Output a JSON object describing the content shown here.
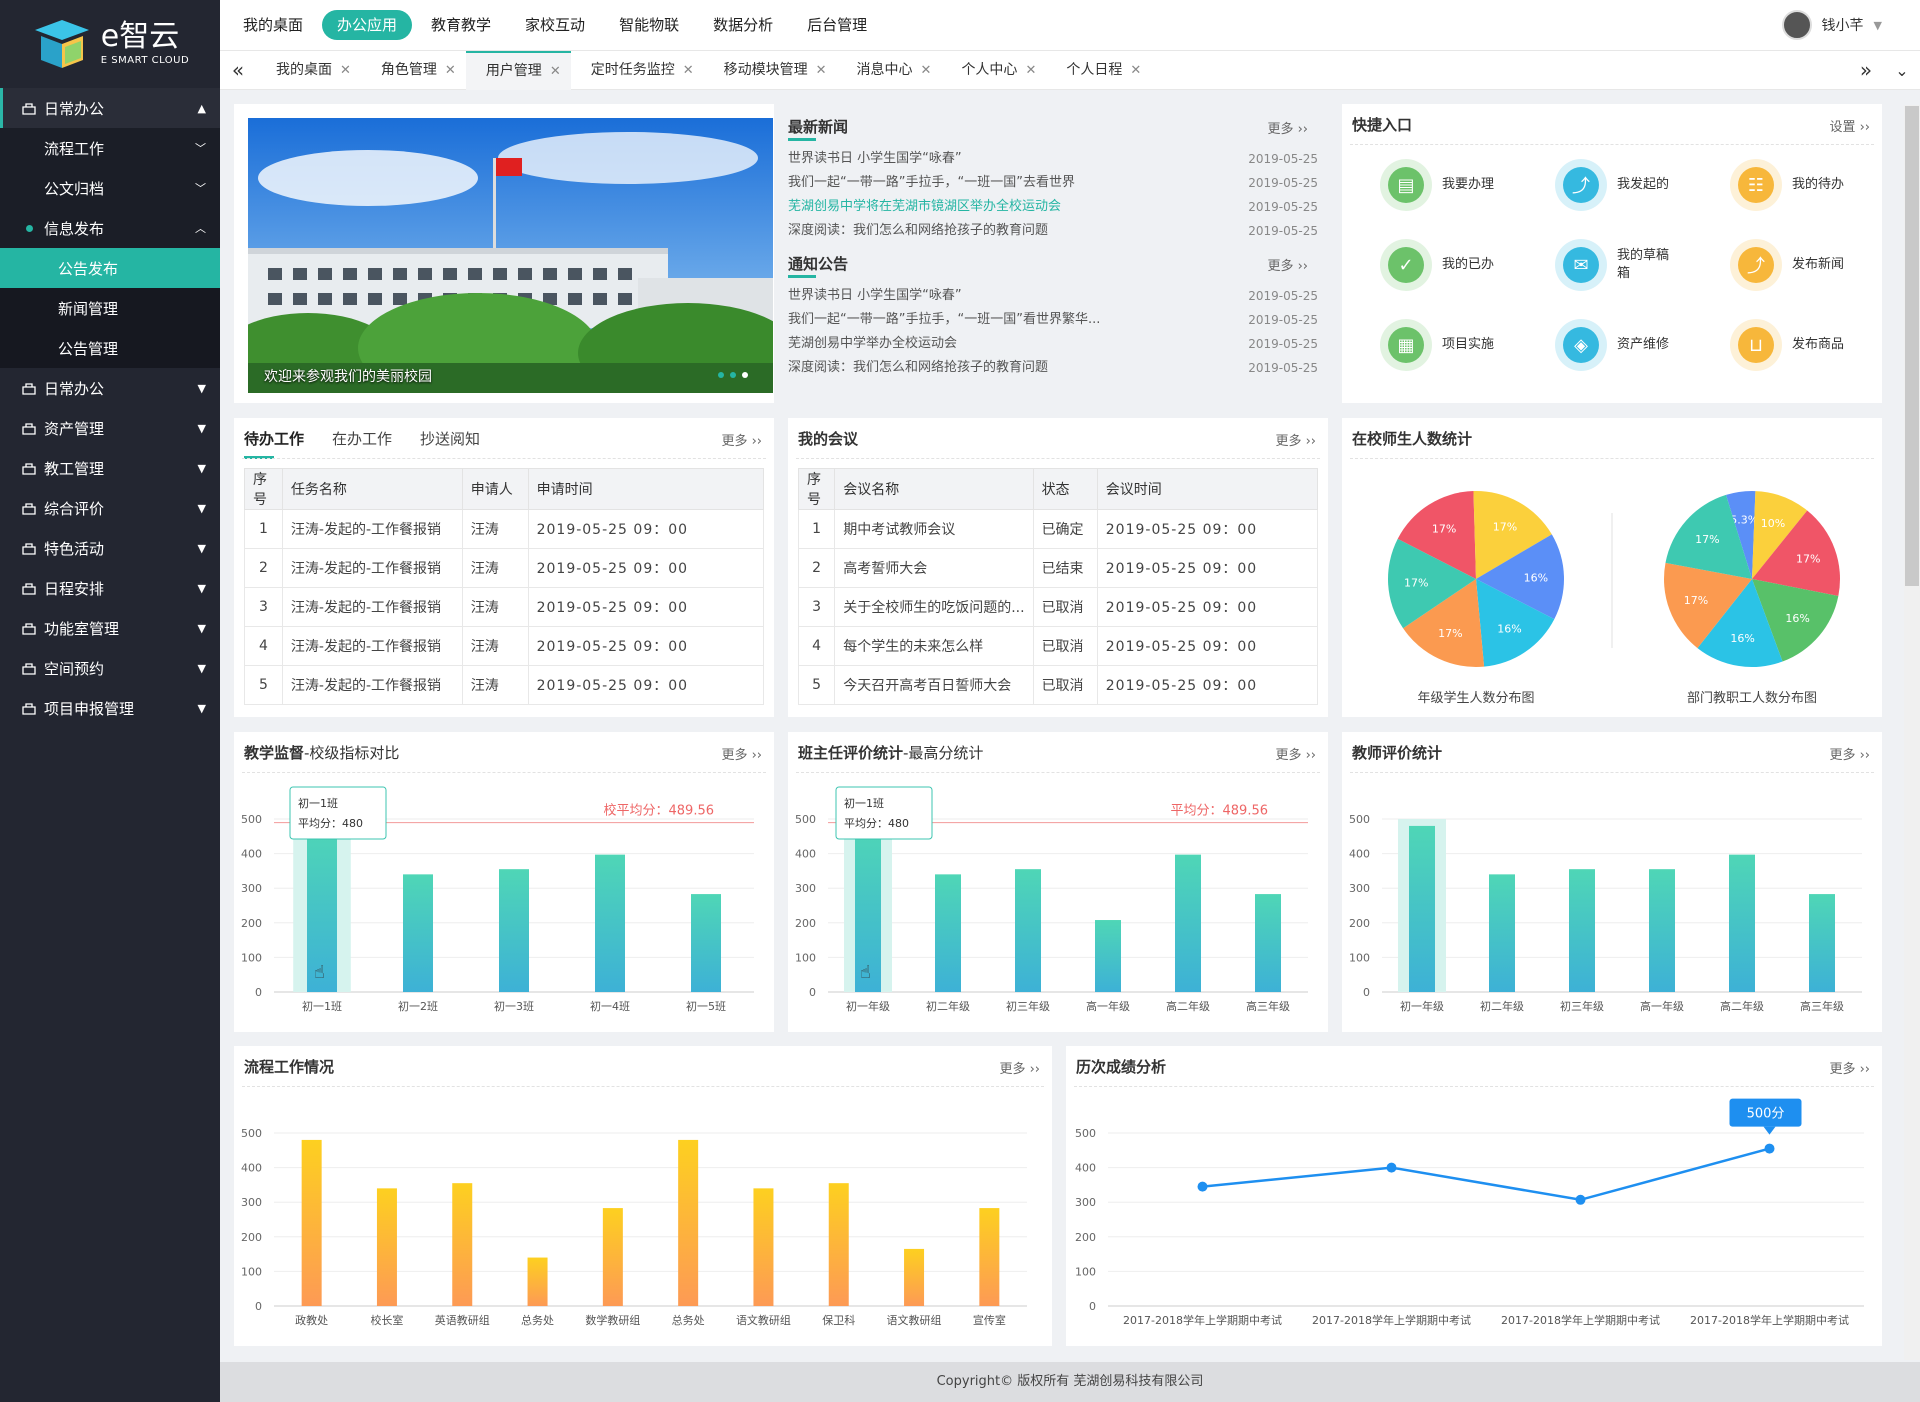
{
  "app": {
    "logo_main": "e智云",
    "logo_sub": "E SMART CLOUD"
  },
  "top_menu": [
    "我的桌面",
    "办公应用",
    "教育教学",
    "家校互动",
    "智能物联",
    "数据分析",
    "后台管理"
  ],
  "user": {
    "name": "钱小芊"
  },
  "tabs": [
    "我的桌面",
    "角色管理",
    "用户管理",
    "定时任务监控",
    "移动模块管理",
    "消息中心",
    "个人中心",
    "个人日程"
  ],
  "sidebar": {
    "top": {
      "label": "日常办公"
    },
    "subs": [
      "流程工作",
      "公文归档",
      "信息发布"
    ],
    "subsubs": [
      "公告发布",
      "新闻管理",
      "公告管理"
    ],
    "rest": [
      "日常办公",
      "资产管理",
      "教工管理",
      "综合评价",
      "特色活动",
      "日程安排",
      "功能室管理",
      "空间预约",
      "项目申报管理"
    ]
  },
  "banner": {
    "caption": "欢迎来参观我们的美丽校园"
  },
  "news": {
    "title": "最新新闻",
    "more": "更多",
    "items": [
      [
        "世界读书日 小学生国学“咏春”",
        "2019-05-25"
      ],
      [
        "我们一起“一带一路”手拉手，“一班一国”去看世界",
        "2019-05-25"
      ],
      [
        "芜湖创易中学将在芜湖市镜湖区举办全校运动会",
        "2019-05-25"
      ],
      [
        "深度阅读：我们怎么和网络抢孩子的教育问题",
        "2019-05-25"
      ]
    ]
  },
  "notice": {
    "title": "通知公告",
    "more": "更多",
    "items": [
      [
        "世界读书日 小学生国学“咏春”",
        "2019-05-25"
      ],
      [
        "我们一起“一带一路”手拉手，“一班一国”看世界繁华...",
        "2019-05-25"
      ],
      [
        "芜湖创易中学举办全校运动会",
        "2019-05-25"
      ],
      [
        "深度阅读：我们怎么和网络抢孩子的教育问题",
        "2019-05-25"
      ]
    ]
  },
  "quick": {
    "title": "快捷入口",
    "setting": "设置",
    "items": [
      {
        "label": "我要办理",
        "color": "#6cc26a"
      },
      {
        "label": "我发起的",
        "color": "#35b9e0"
      },
      {
        "label": "我的待办",
        "color": "#f7b73b"
      },
      {
        "label": "我的已办",
        "color": "#6cc26a"
      },
      {
        "label": "我的草稿箱",
        "color": "#35b9e0"
      },
      {
        "label": "发布新闻",
        "color": "#f7b73b"
      },
      {
        "label": "项目实施",
        "color": "#6cc26a"
      },
      {
        "label": "资产维修",
        "color": "#35b9e0"
      },
      {
        "label": "发布商品",
        "color": "#f7b73b"
      }
    ]
  },
  "todo": {
    "tabs": [
      "待办工作",
      "在办工作",
      "抄送阅知"
    ],
    "more": "更多",
    "headers": [
      "序号",
      "任务名称",
      "申请人",
      "申请时间"
    ],
    "rows": [
      [
        "1",
        "汪涛-发起的-工作餐报销",
        "汪涛",
        "2019-05-25 09：00"
      ],
      [
        "2",
        "汪涛-发起的-工作餐报销",
        "汪涛",
        "2019-05-25 09：00"
      ],
      [
        "3",
        "汪涛-发起的-工作餐报销",
        "汪涛",
        "2019-05-25 09：00"
      ],
      [
        "4",
        "汪涛-发起的-工作餐报销",
        "汪涛",
        "2019-05-25 09：00"
      ],
      [
        "5",
        "汪涛-发起的-工作餐报销",
        "汪涛",
        "2019-05-25 09：00"
      ]
    ]
  },
  "meeting": {
    "title": "我的会议",
    "more": "更多",
    "headers": [
      "序号",
      "会议名称",
      "状态",
      "会议时间"
    ],
    "rows": [
      [
        "1",
        "期中考试教师会议",
        "已确定",
        "2019-05-25 09：00"
      ],
      [
        "2",
        "高考誓师大会",
        "已结束",
        "2019-05-25 09：00"
      ],
      [
        "3",
        "关于全校师生的吃饭问题的...",
        "已取消",
        "2019-05-25 09：00"
      ],
      [
        "4",
        "每个学生的未来怎么样",
        "已取消",
        "2019-05-25 09：00"
      ],
      [
        "5",
        "今天召开高考百日誓师大会",
        "已取消",
        "2019-05-25 09：00"
      ]
    ]
  },
  "pie_card": {
    "title": "在校师生人数统计"
  },
  "card_titles": {
    "c1_main": "教学监督",
    "c1_sub": "-校级指标对比",
    "c2_main": "班主任评价统计",
    "c2_sub": "-最高分统计",
    "c3": "教师评价统计",
    "c4": "流程工作情况",
    "c5": "历次成绩分析",
    "more": "更多"
  },
  "chart_data": [
    {
      "type": "pie",
      "xlabel": "年级学生人数分布图",
      "values": [
        17,
        17,
        16,
        16,
        17,
        17
      ],
      "labels": [
        "17%",
        "17%",
        "16%",
        "16%",
        "17%",
        "17%"
      ],
      "colors": [
        "#f05567",
        "#fbd03c",
        "#5b8ff7",
        "#2bc3e6",
        "#fb9a50",
        "#3ec9b1"
      ]
    },
    {
      "type": "pie",
      "xlabel": "部门教职工人数分布图",
      "values": [
        5.3,
        10,
        17,
        16,
        16,
        17,
        17
      ],
      "labels": [
        "5.3%",
        "10%",
        "17%",
        "16%",
        "16%",
        "17%",
        "17%"
      ],
      "colors": [
        "#5b8ff7",
        "#fbd03c",
        "#f05567",
        "#58c169",
        "#2bc3e6",
        "#fb9a50",
        "#3ec9b1"
      ]
    },
    {
      "type": "bar",
      "categories": [
        "初一1班",
        "初一2班",
        "初一3班",
        "初一4班",
        "初一5班"
      ],
      "values": [
        480,
        340,
        355,
        397,
        283
      ],
      "yticks": [
        "0",
        "100",
        "200",
        "300",
        "400",
        "500"
      ],
      "avg": 489.56,
      "avg_label": "校平均分：489.56",
      "tooltip": {
        "title": "初一1班",
        "value": "平均分：480"
      }
    },
    {
      "type": "bar",
      "categories": [
        "初一年级",
        "初二年级",
        "初三年级",
        "高一年级",
        "高二年级",
        "高三年级"
      ],
      "values": [
        480,
        340,
        355,
        208,
        397,
        283
      ],
      "yticks": [
        "0",
        "100",
        "200",
        "300",
        "400",
        "500"
      ],
      "avg": 489.56,
      "avg_label": "平均分：489.56",
      "tooltip": {
        "title": "初一1班",
        "value": "平均分：480"
      }
    },
    {
      "type": "bar",
      "categories": [
        "初一年级",
        "初二年级",
        "初三年级",
        "高一年级",
        "高二年级",
        "高三年级"
      ],
      "values": [
        480,
        340,
        355,
        355,
        397,
        283
      ],
      "yticks": [
        "0",
        "100",
        "200",
        "300",
        "400",
        "500"
      ]
    },
    {
      "type": "bar",
      "categories": [
        "政教处",
        "校长室",
        "英语教研组",
        "总务处",
        "数学教研组",
        "总务处",
        "语文教研组",
        "保卫科",
        "语文教研组",
        "宣传室"
      ],
      "values": [
        480,
        340,
        355,
        140,
        283,
        480,
        340,
        355,
        165,
        283
      ],
      "yticks": [
        "0",
        "100",
        "200",
        "300",
        "400",
        "500"
      ]
    },
    {
      "type": "line",
      "categories": [
        "2017-2018学年上学期期中考试",
        "2017-2018学年上学期期中考试",
        "2017-2018学年上学期期中考试",
        "2017-2018学年上学期期中考试"
      ],
      "values": [
        345,
        400,
        307,
        455
      ],
      "yticks": [
        "0",
        "100",
        "200",
        "300",
        "400",
        "500"
      ],
      "tooltip": "500分"
    }
  ],
  "footer": "Copyright© 版权所有 芜湖创易科技有限公司"
}
